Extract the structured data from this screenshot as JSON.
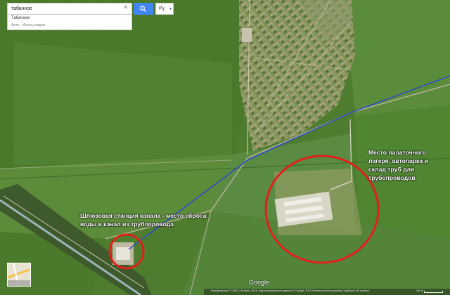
{
  "search": {
    "value": "табачное",
    "clear_icon": "close-icon",
    "button_icon": "search-icon"
  },
  "language": {
    "label": "Ру"
  },
  "suggestion": {
    "title": "Табачное",
    "subtitle": "Фото · Искать рядом"
  },
  "annotations": {
    "lock_station": "Шлюзовая станция канала - место сброса воды в канал из трубопровода",
    "camp": "Место палаточного лагеря, автопарка и склад труб для трубопроводов"
  },
  "map_footer": {
    "logo": "Google",
    "copyright": "Изображения © CNES / Astrium, 2015, Картографические данные © Google, 2015     Условия использования     Сообщить об ошибке",
    "scale_label": "200 м"
  },
  "layer_switch": {
    "label": "Карта"
  },
  "colors": {
    "pipeline_line": "#2a45d8",
    "highlight_circle": "#e0201a",
    "search_button": "#4285f4"
  }
}
